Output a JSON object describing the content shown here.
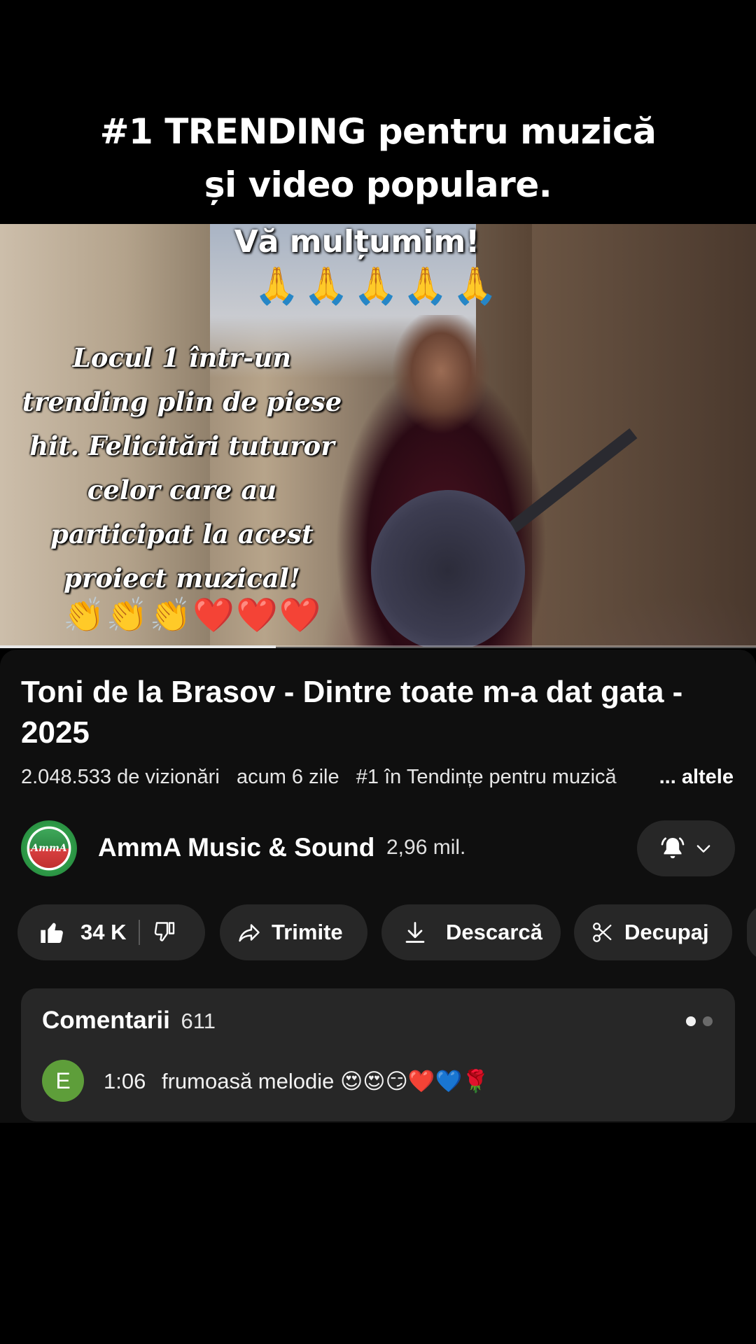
{
  "overlay": {
    "caption_line1": "#1 TRENDING pentru muzică",
    "caption_line2": "și video populare."
  },
  "video_frame": {
    "thanks": "Vă mulțumim!",
    "pray_emojis": "🙏🙏🙏🙏🙏",
    "message_lines": [
      "Locul 1 într-un",
      "trending plin de piese",
      "hit. Felicitări tuturor",
      "celor care au",
      "participat la acest",
      "proiect muzical!"
    ],
    "emoji_row": "👏👏👏❤️❤️❤️",
    "progress": 0.365
  },
  "video": {
    "title": "Toni de la Brasov - Dintre toate m-a dat gata - 2025",
    "views": "2.048.533 de vizionări",
    "age": "acum 6 zile",
    "trending": "#1 în Tendințe pentru muzică",
    "more": "... altele"
  },
  "channel": {
    "name": "AmmA Music & Sound",
    "subscribers": "2,96 mil.",
    "avatar_text": "AmmA",
    "bell_icon": "bell-icon",
    "chevron_icon": "chevron-down-icon"
  },
  "actions": {
    "likes": "34 K",
    "share": "Trimite",
    "download": "Descarcă",
    "clip": "Decupaj"
  },
  "comments": {
    "label": "Comentarii",
    "count": "611",
    "first": {
      "avatar_letter": "E",
      "timestamp": "1:06",
      "text": "frumoasă melodie 😍😍😏❤️💙🌹"
    }
  },
  "colors": {
    "background": "#000000",
    "sheet": "#0f0f0f",
    "pill": "#272727",
    "comment_avatar": "#5e9e3a"
  }
}
